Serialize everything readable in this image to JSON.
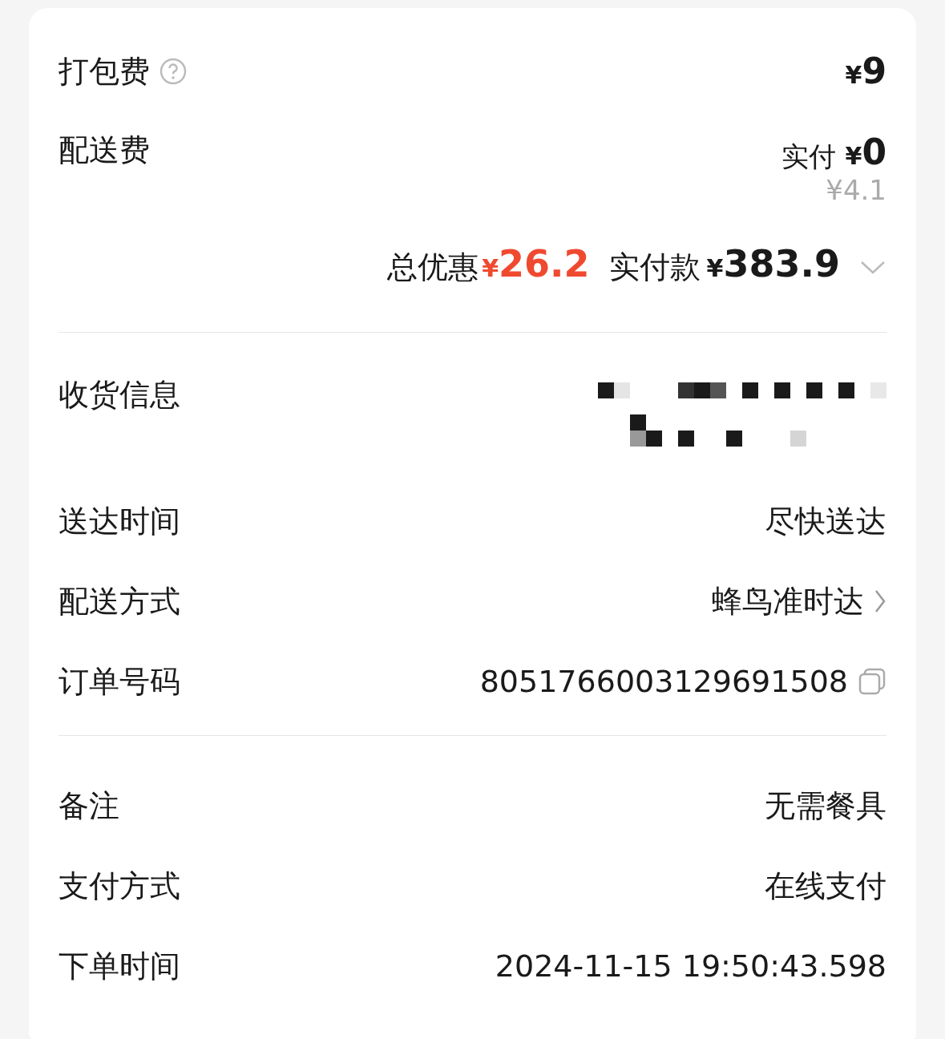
{
  "packing_fee": {
    "label": "打包费",
    "currency": "¥",
    "amount": "9"
  },
  "delivery_fee": {
    "label": "配送费",
    "paid_label": "实付",
    "currency": "¥",
    "amount": "0",
    "original": "¥4.1"
  },
  "summary": {
    "discount_label": "总优惠",
    "discount_currency": "¥",
    "discount": "26.2",
    "paid_label": "实付款",
    "paid_currency": "¥",
    "paid": "383.9"
  },
  "info_rows": [
    {
      "kind": "redacted",
      "label": "收货信息"
    },
    {
      "kind": "text",
      "label": "送达时间",
      "value": "尽快送达"
    },
    {
      "kind": "link",
      "label": "配送方式",
      "value": "蜂鸟准时达"
    },
    {
      "kind": "copy",
      "label": "订单号码",
      "value": "8051766003129691508"
    }
  ],
  "extra_rows": [
    {
      "label": "备注",
      "value": "无需餐具"
    },
    {
      "label": "支付方式",
      "value": "在线支付"
    },
    {
      "label": "下单时间",
      "value": "2024-11-15 19:50:43.598"
    }
  ]
}
